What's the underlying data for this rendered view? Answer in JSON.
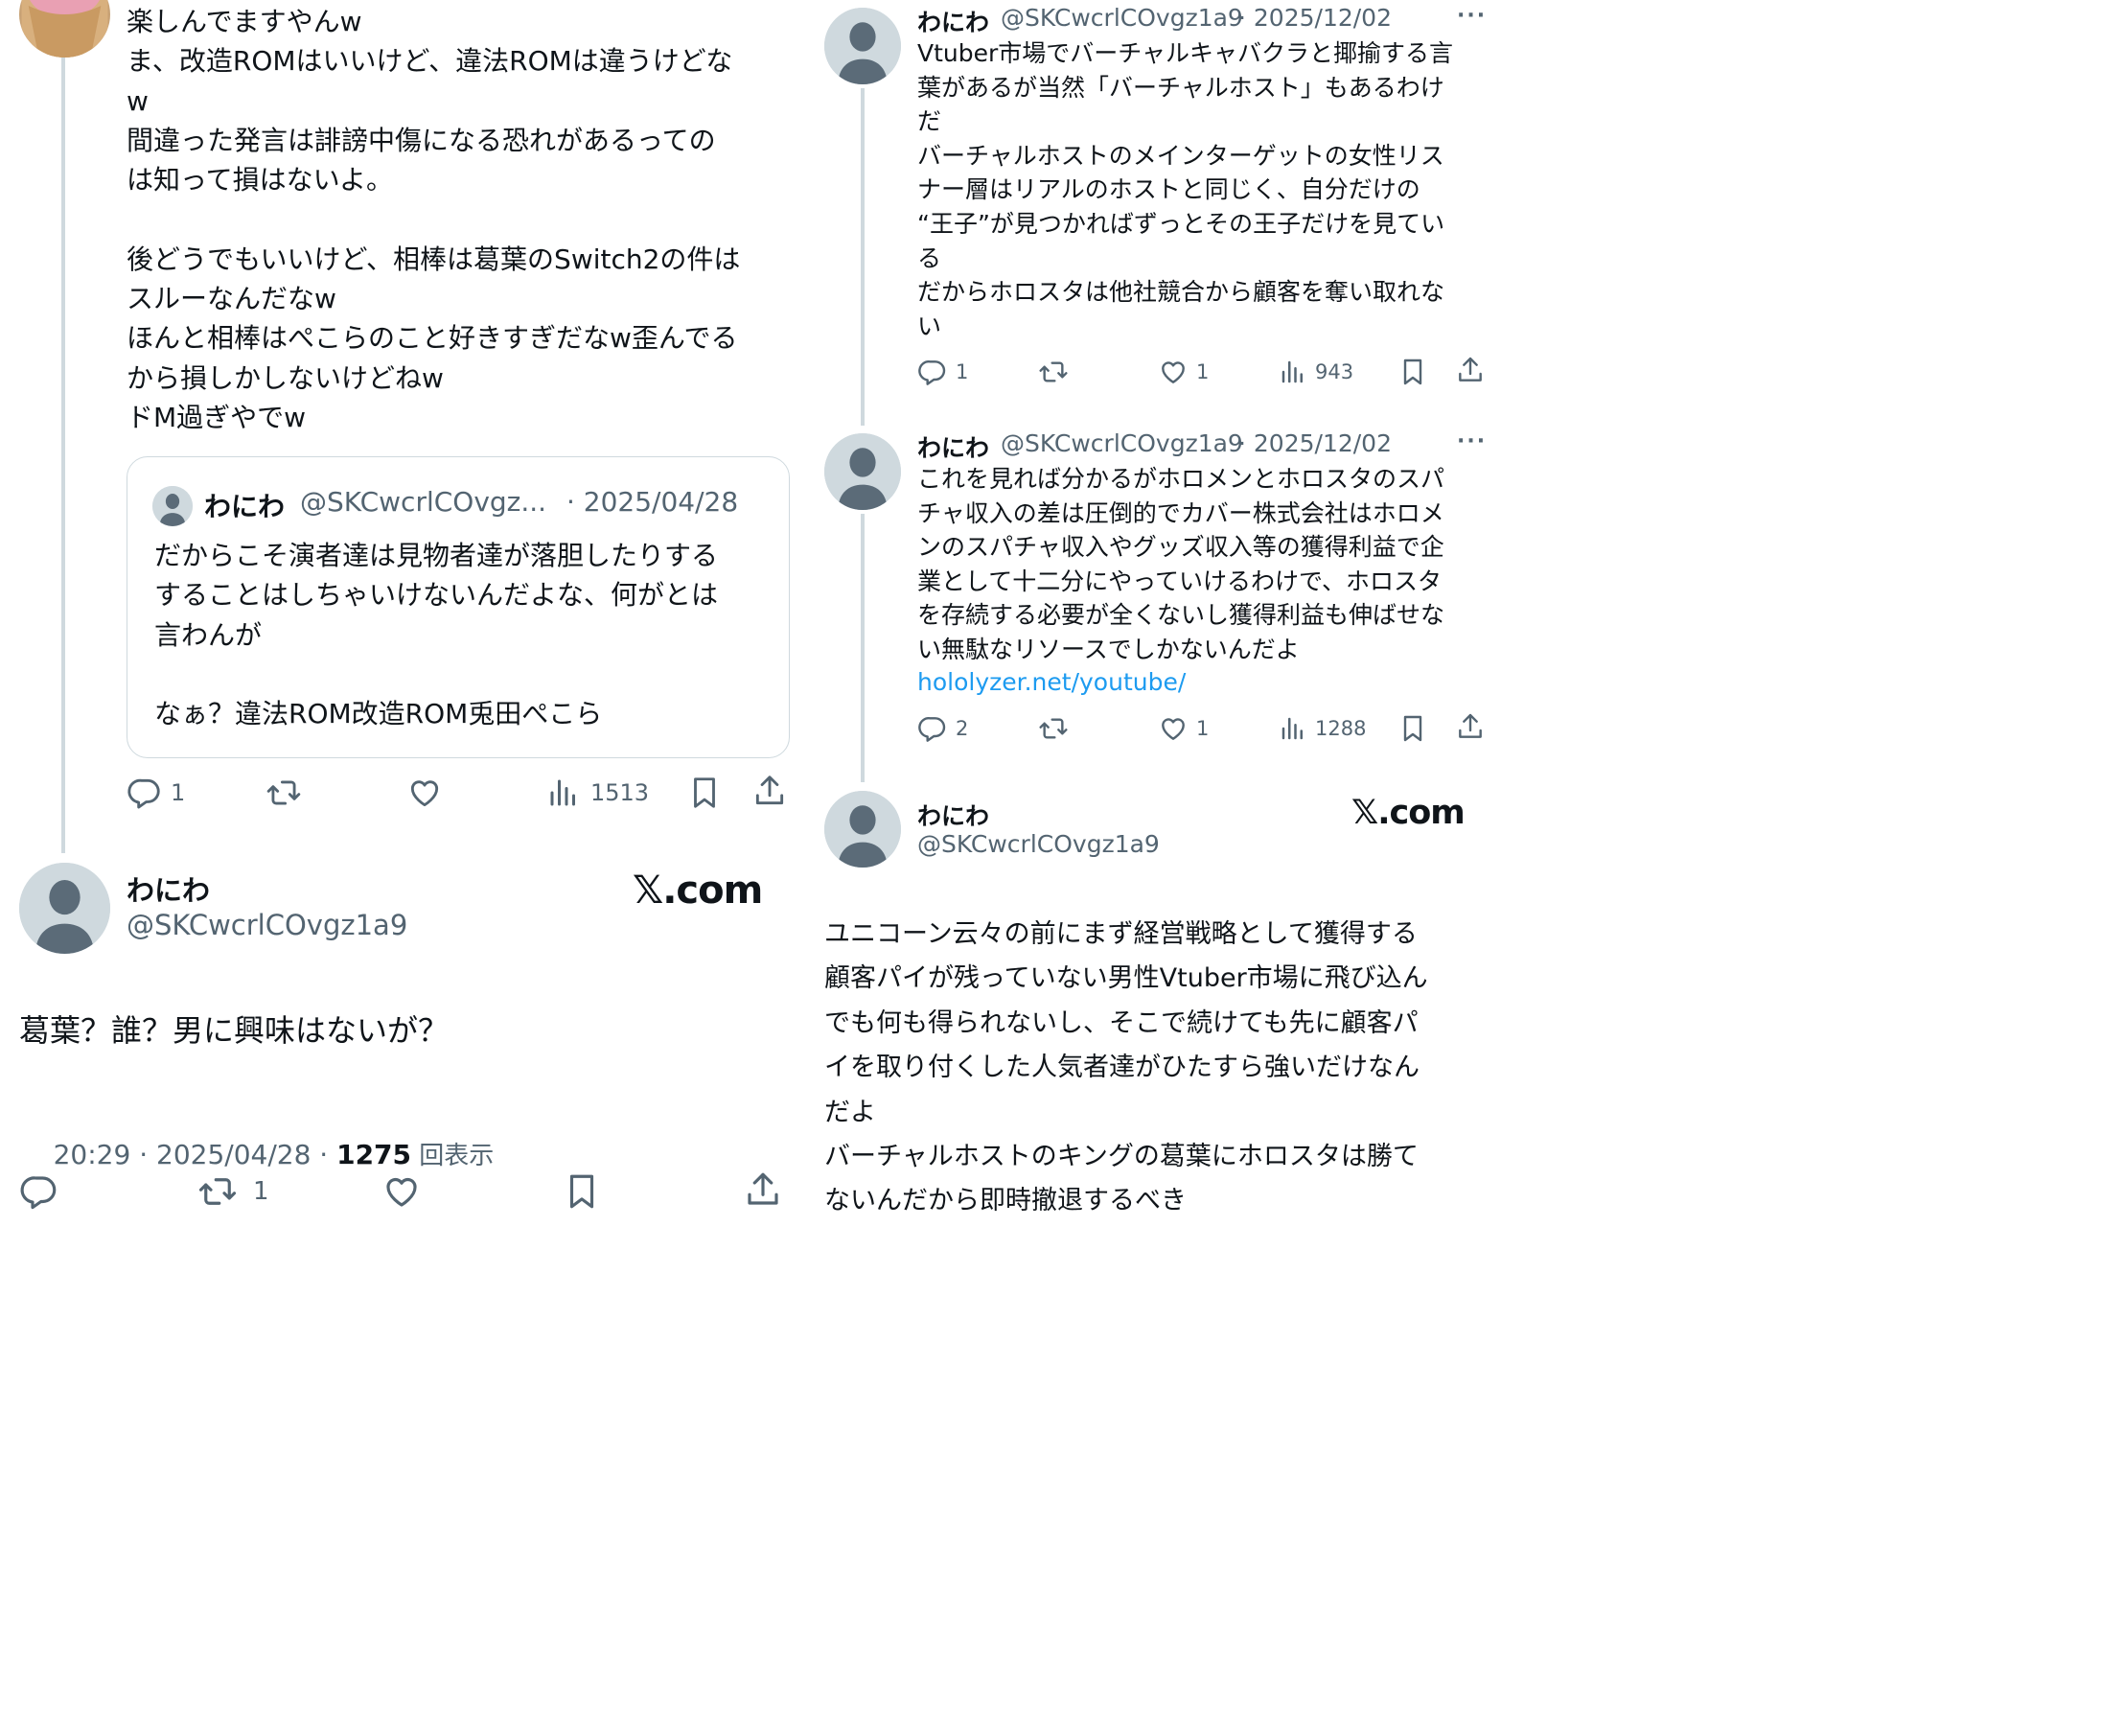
{
  "left": {
    "reply_body": "楽しんでますやんw\nま、改造ROMはいいけど、違法ROMは違うけどな\nw\n間違った発言は誹謗中傷になる恐れがあるっての\nは知って損はないよ。\n\n後どうでもいいけど、相棒は葛葉のSwitch2の件は\nスルーなんだなw\nほんと相棒はぺこらのこと好きすぎだなw歪んでる\nから損しかしないけどねw\nドM過ぎやでw",
    "quote": {
      "name": "わにわ",
      "handle": "@SKCwcrlCOvgz...",
      "date": "· 2025/04/28",
      "body": "だからこそ演者達は見物者達が落胆したりする\nすることはしちゃいけないんだよな、何がとは\n言わんが\n\nなぁ？違法ROM改造ROM兎田ぺこら"
    },
    "reply_actions": {
      "replies": "1",
      "views": "1513"
    },
    "main": {
      "name": "わにわ",
      "handle": "@SKCwcrlCOvgz1a9",
      "brand": "𝕏.com",
      "body": "葛葉？誰？男に興味はないが？",
      "time": "20:29 · 2025/04/28 · ",
      "views_count": "1275",
      "views_label": " 回表示",
      "retweets": "1"
    }
  },
  "right": {
    "post1": {
      "name": "わにわ",
      "handle": "@SKCwcrlCOvgz1a9",
      "date": "· 2025/12/02",
      "more": "···",
      "body": "Vtuber市場でバーチャルキャバクラと揶揄する言\n葉があるが当然「バーチャルホスト」もあるわけ\nだ\nバーチャルホストのメインターゲットの女性リス\nナー層はリアルのホストと同じく、自分だけの\n“王子”が見つかればずっとその王子だけを見てい\nる\nだからホロスタは他社競合から顧客を奪い取れな\nい",
      "replies": "1",
      "likes": "1",
      "views": "943"
    },
    "post2": {
      "name": "わにわ",
      "handle": "@SKCwcrlCOvgz1a9",
      "date": "· 2025/12/02",
      "more": "···",
      "body": "これを見れば分かるがホロメンとホロスタのスパ\nチャ収入の差は圧倒的でカバー株式会社はホロメ\nンのスパチャ収入やグッズ収入等の獲得利益で企\n業として十二分にやっていけるわけで、ホロスタ\nを存続する必要が全くないし獲得利益も伸ばせな\nい無駄なリソースでしかないんだよ",
      "link": "hololyzer.net/youtube/",
      "replies": "2",
      "likes": "1",
      "views": "1288"
    },
    "main": {
      "name": "わにわ",
      "handle": "@SKCwcrlCOvgz1a9",
      "brand": "𝕏.com",
      "body": "ユニコーン云々の前にまず経営戦略として獲得する\n顧客パイが残っていない男性Vtuber市場に飛び込ん\nでも何も得られないし、そこで続けても先に顧客パ\nイを取り付くした人気者達がひたすら強いだけなん\nだよ\nバーチャルホストのキングの葛葉にホロスタは勝て\nないんだから即時撤退するべき"
    }
  },
  "colors": {
    "link": "#1d9bf0",
    "gray": "#536471",
    "border": "#cfd9de"
  }
}
